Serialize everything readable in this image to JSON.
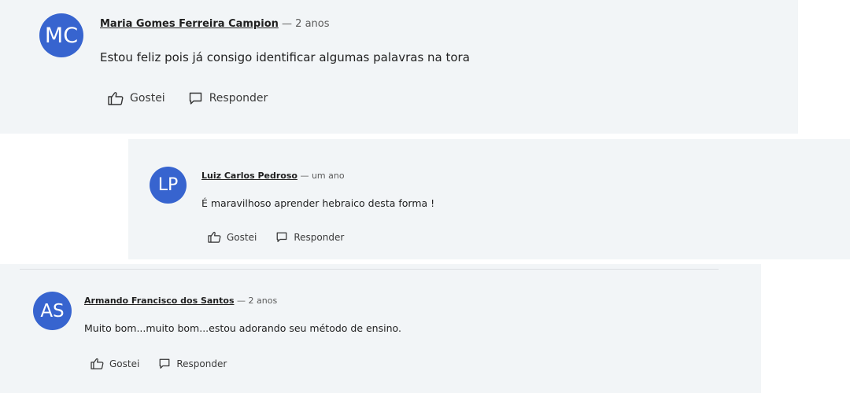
{
  "comments": [
    {
      "avatar_initials": "MC",
      "author": "Maria Gomes Ferreira Campion",
      "separator": "—",
      "time": "2 anos",
      "text": "Estou feliz pois já consigo identificar algumas palavras na tora",
      "like_label": "Gostei",
      "reply_label": "Responder"
    },
    {
      "avatar_initials": "LP",
      "author": "Luiz Carlos Pedroso",
      "separator": "—",
      "time": "um ano",
      "text": "É maravilhoso aprender hebraico desta forma !",
      "like_label": "Gostei",
      "reply_label": "Responder"
    },
    {
      "avatar_initials": "AS",
      "author": "Armando Francisco dos Santos",
      "separator": "—",
      "time": "2 anos",
      "text": "Muito bom...muito bom...estou adorando seu método de ensino.",
      "like_label": "Gostei",
      "reply_label": "Responder"
    }
  ],
  "colors": {
    "avatar_bg": "#3764cf",
    "card_bg": "#f2f5f7"
  },
  "icons": {
    "like": "thumbs-up-icon",
    "reply": "speech-bubble-icon"
  }
}
